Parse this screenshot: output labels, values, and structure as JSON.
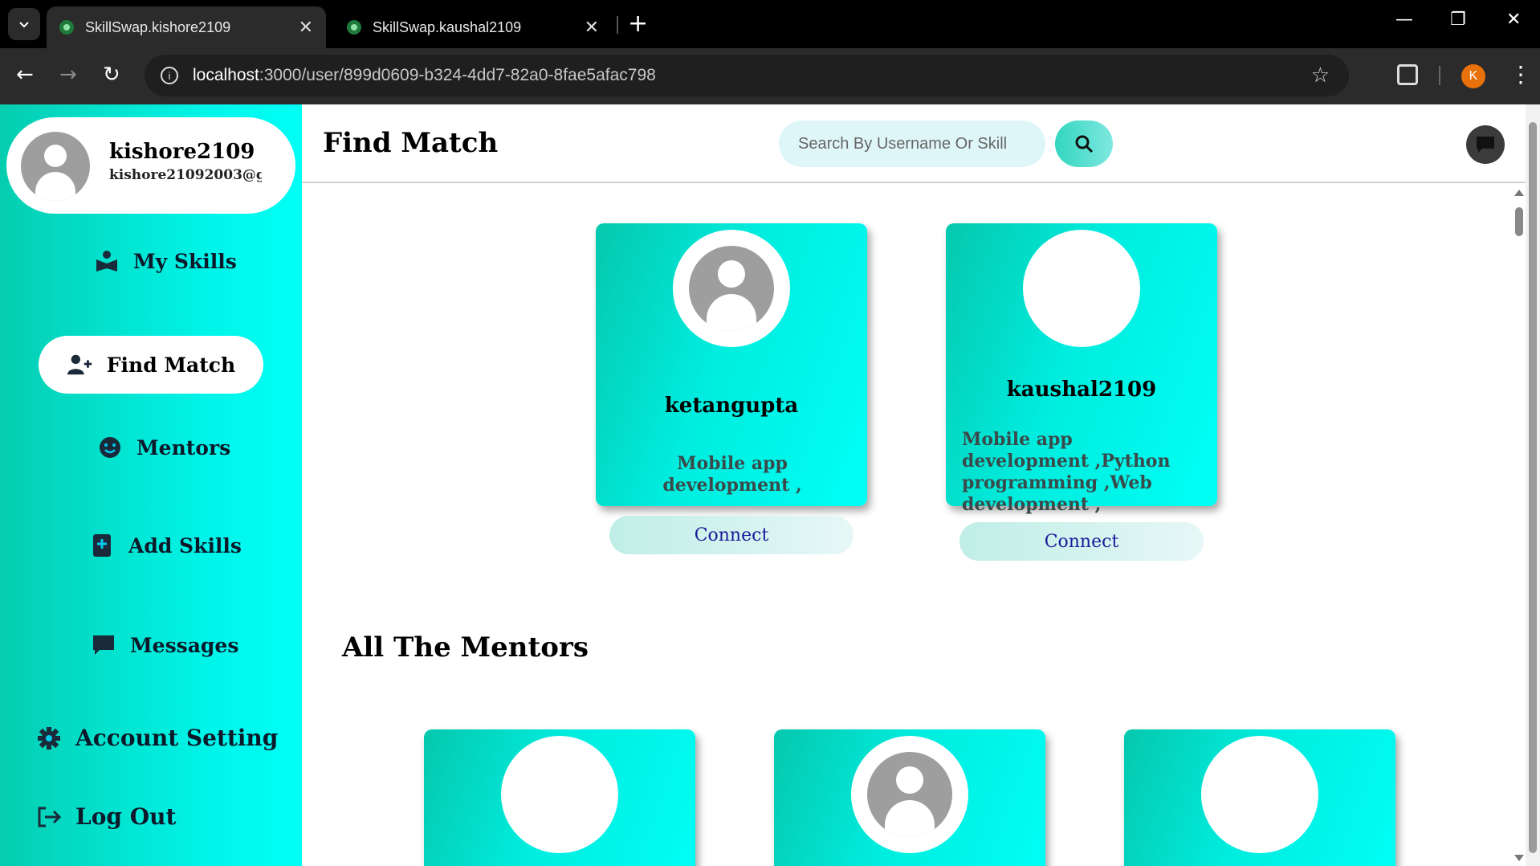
{
  "browser": {
    "tabs": [
      {
        "title": "SkillSwap.kishore2109",
        "active": true
      },
      {
        "title": "SkillSwap.kaushal2109",
        "active": false
      }
    ],
    "url_host": "localhost",
    "url_path": ":3000/user/899d0609-b324-4dd7-82a0-8fae5afac798",
    "profile_initial": "K"
  },
  "sidebar": {
    "user": {
      "username": "kishore2109",
      "email": "kishore21092003@gn"
    },
    "items": [
      {
        "label": "My Skills",
        "icon": "book-reader-icon"
      },
      {
        "label": "Find Match",
        "icon": "user-plus-icon",
        "active": true
      },
      {
        "label": "Mentors",
        "icon": "smile-icon"
      },
      {
        "label": "Add Skills",
        "icon": "book-plus-icon"
      },
      {
        "label": "Messages",
        "icon": "message-icon"
      },
      {
        "label": "Account Setting",
        "icon": "gear-icon"
      },
      {
        "label": "Log Out",
        "icon": "logout-icon"
      }
    ]
  },
  "header": {
    "title": "Find Match",
    "search_placeholder": "Search By Username Or Skill"
  },
  "matches": [
    {
      "username": "ketangupta",
      "skills": "Mobile app development ,",
      "connect_label": "Connect",
      "avatar": "default"
    },
    {
      "username": "kaushal2109",
      "skills": "Mobile app development ,Python programming ,Web development ,",
      "connect_label": "Connect",
      "avatar": "photo"
    }
  ],
  "mentors_section": {
    "title": "All The Mentors"
  },
  "colors": {
    "accent": "#00f5ea",
    "accent_dark": "#05cdb0",
    "connect_text": "#1a1a9a"
  }
}
